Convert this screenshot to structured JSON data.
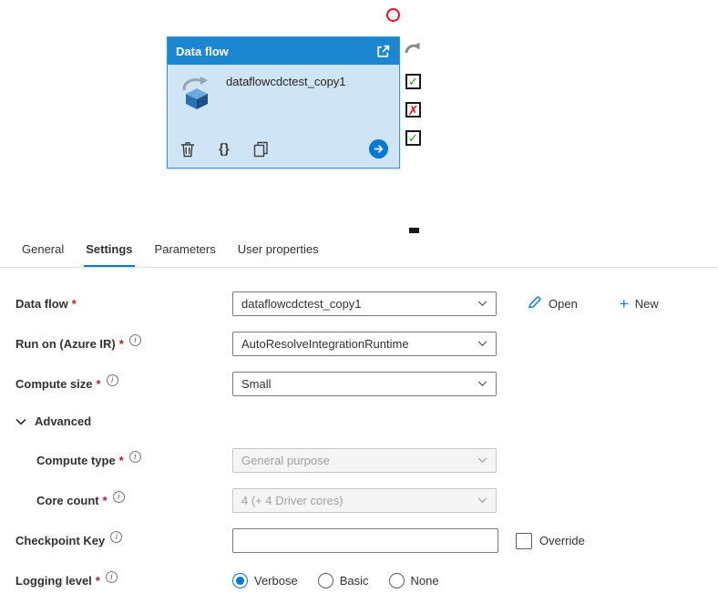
{
  "canvas": {
    "card": {
      "title": "Data flow",
      "name": "dataflowcdctest_copy1"
    },
    "status_icons": [
      "redo-icon",
      "checkbox-checked-green",
      "checkbox-cross-red",
      "checkbox-checked-green"
    ]
  },
  "icons": {
    "braces": "{}",
    "check": "✓",
    "cross": "✗",
    "plus": "+",
    "info": "i"
  },
  "tabs": [
    {
      "label": "General"
    },
    {
      "label": "Settings"
    },
    {
      "label": "Parameters"
    },
    {
      "label": "User properties"
    }
  ],
  "form": {
    "data_flow": {
      "label": "Data flow",
      "required": "*",
      "value": "dataflowcdctest_copy1",
      "open_label": "Open",
      "new_label": "New"
    },
    "run_on": {
      "label": "Run on (Azure IR)",
      "required": "*",
      "value": "AutoResolveIntegrationRuntime"
    },
    "compute_size": {
      "label": "Compute size",
      "required": "*",
      "value": "Small"
    },
    "advanced": {
      "label": "Advanced"
    },
    "compute_type": {
      "label": "Compute type",
      "required": "*",
      "value": "General purpose",
      "disabled": true
    },
    "core_count": {
      "label": "Core count",
      "required": "*",
      "value": "4 (+ 4 Driver cores)",
      "disabled": true
    },
    "checkpoint_key": {
      "label": "Checkpoint Key",
      "value": "",
      "override_label": "Override",
      "override_checked": false
    },
    "logging_level": {
      "label": "Logging level",
      "required": "*",
      "options": [
        "Verbose",
        "Basic",
        "None"
      ],
      "selected": "Verbose"
    }
  },
  "colors": {
    "accent": "#0078d4",
    "card_header": "#1d86d0",
    "card_body": "#cfe4f5",
    "check_green": "#18a318",
    "cross_red": "#e81123",
    "required_red": "#a4262c"
  }
}
